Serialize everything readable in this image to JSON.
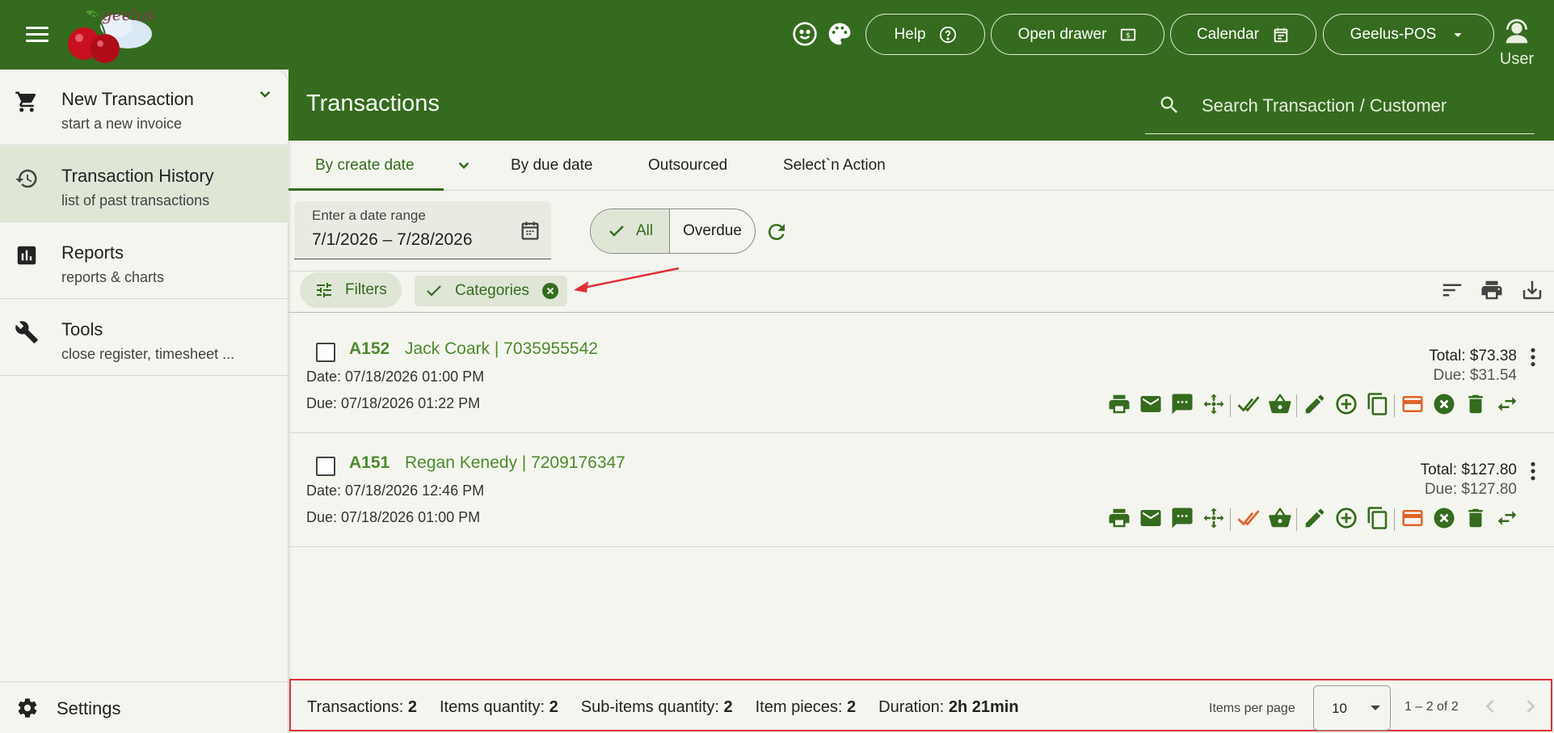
{
  "topbar": {
    "logo_text": "geelus",
    "help_label": "Help",
    "drawer_label": "Open drawer",
    "calendar_label": "Calendar",
    "pos_label": "Geelus-POS",
    "user_label": "User"
  },
  "sidebar": {
    "items": [
      {
        "title": "New Transaction",
        "sub": "start a new invoice",
        "icon": "cart-icon"
      },
      {
        "title": "Transaction History",
        "sub": "list of past transactions",
        "icon": "history-icon"
      },
      {
        "title": "Reports",
        "sub": "reports & charts",
        "icon": "chart-icon"
      },
      {
        "title": "Tools",
        "sub": "close register, timesheet ...",
        "icon": "wrench-icon"
      }
    ],
    "settings_label": "Settings"
  },
  "header": {
    "title": "Transactions",
    "search_placeholder": "Search Transaction / Customer"
  },
  "tabs": [
    "By create date",
    "By due date",
    "Outsourced",
    "Select`n Action"
  ],
  "date_range": {
    "label": "Enter a date range",
    "value": "7/1/2026  – 7/28/2026"
  },
  "status_toggle": {
    "all_label": "All",
    "overdue_label": "Overdue"
  },
  "chips": {
    "filters_label": "Filters",
    "categories_label": "Categories"
  },
  "transactions": [
    {
      "id": "A152",
      "customer": "Jack Coark | 7035955542",
      "date": "Date: 07/18/2026 01:00 PM",
      "due": "Due: 07/18/2026 01:22 PM",
      "total": "Total: $73.38",
      "due_amount": "Due: $31.54",
      "done_color": "#356b1f"
    },
    {
      "id": "A151",
      "customer": "Regan Kenedy | 7209176347",
      "date": "Date: 07/18/2026 12:46 PM",
      "due": "Due: 07/18/2026 01:00 PM",
      "total": "Total: $127.80",
      "due_amount": "Due: $127.80",
      "done_color": "#e0642a"
    }
  ],
  "footer": {
    "stats": [
      {
        "label": "Transactions: ",
        "value": "2"
      },
      {
        "label": "Items quantity: ",
        "value": "2"
      },
      {
        "label": "Sub-items quantity: ",
        "value": "2"
      },
      {
        "label": "Item pieces: ",
        "value": "2"
      },
      {
        "label": "Duration: ",
        "value": "2h 21min"
      }
    ],
    "items_per_page_label": "Items per page",
    "items_per_page_value": "10",
    "range_label": "1 – 2 of 2"
  },
  "colors": {
    "brand_green": "#356b1f",
    "accent_orange": "#e0642a",
    "highlight_red": "#e0303a"
  }
}
